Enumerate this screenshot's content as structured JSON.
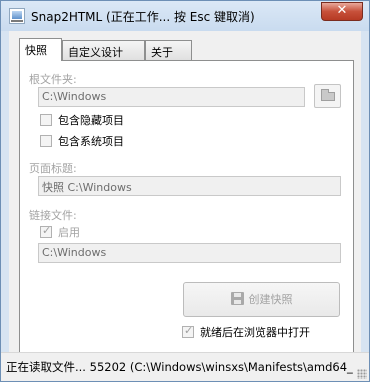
{
  "window": {
    "title": "Snap2HTML (正在工作... 按 Esc 键取消)",
    "close_glyph": "✕"
  },
  "tabs": [
    "快照",
    "自定义设计",
    "关于"
  ],
  "snapshot": {
    "root_label": "根文件夹:",
    "root_value": "C:\\Windows",
    "include_hidden": "包含隐藏项目",
    "include_system": "包含系统项目",
    "page_title_label": "页面标题:",
    "page_title_value": "快照 C:\\Windows",
    "link_files_label": "链接文件:",
    "enable_label": "启用",
    "enable_checked": true,
    "link_root_value": "C:\\Windows",
    "create_button": "创建快照",
    "open_after": "就绪后在浏览器中打开",
    "open_after_checked": true
  },
  "status": {
    "text": "正在读取文件... 55202 (C:\\Windows\\winsxs\\Manifests\\amd64_"
  },
  "icons": {
    "app": "snap2html-app-icon",
    "folder": "folder-icon",
    "save": "floppy-disk-icon"
  }
}
